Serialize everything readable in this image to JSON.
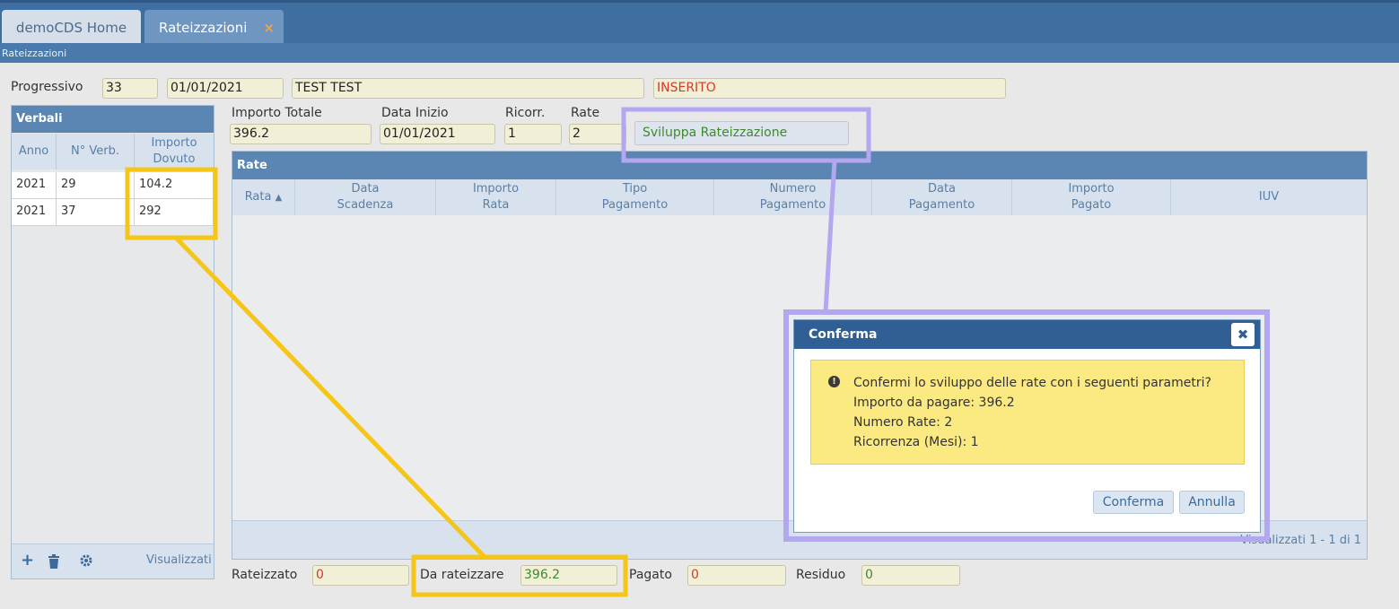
{
  "tabs": [
    {
      "label": "demoCDS Home"
    },
    {
      "label": "Rateizzazioni",
      "close": "×"
    }
  ],
  "breadcrumb": "Rateizzazioni",
  "header": {
    "progressivo_label": "Progressivo",
    "progressivo": "33",
    "data": "01/01/2021",
    "nome": "TEST TEST",
    "stato": "INSERITO"
  },
  "params": {
    "importo_totale_label": "Importo Totale",
    "importo_totale": "396.2",
    "data_inizio_label": "Data Inizio",
    "data_inizio": "01/01/2021",
    "ricorr_label": "Ricorr.",
    "ricorr": "1",
    "rate_label": "Rate",
    "rate": "2",
    "sviluppa_button": "Sviluppa Rateizzazione"
  },
  "verbali": {
    "title": "Verbali",
    "columns": [
      "Anno",
      "N° Verb.",
      "Importo Dovuto"
    ],
    "rows": [
      {
        "anno": "2021",
        "numero": "29",
        "importo": "104.2"
      },
      {
        "anno": "2021",
        "numero": "37",
        "importo": "292"
      }
    ],
    "footer_text": "Visualizzati"
  },
  "rate_grid": {
    "title": "Rate",
    "columns": [
      {
        "line1": "Rata",
        "line2": ""
      },
      {
        "line1": "Data",
        "line2": "Scadenza"
      },
      {
        "line1": "Importo",
        "line2": "Rata"
      },
      {
        "line1": "Tipo",
        "line2": "Pagamento"
      },
      {
        "line1": "Numero",
        "line2": "Pagamento"
      },
      {
        "line1": "Data",
        "line2": "Pagamento"
      },
      {
        "line1": "Importo",
        "line2": "Pagato"
      },
      {
        "line1": "IUV",
        "line2": ""
      }
    ],
    "footer_text": "Visualizzati 1 - 1 di 1"
  },
  "totals": {
    "rateizzato_label": "Rateizzato",
    "rateizzato": "0",
    "da_rateizzare_label": "Da rateizzare",
    "da_rateizzare": "396.2",
    "pagato_label": "Pagato",
    "pagato": "0",
    "residuo_label": "Residuo",
    "residuo": "0"
  },
  "dialog": {
    "title": "Conferma",
    "close": "✖",
    "message_lines": [
      "Confermi lo sviluppo delle rate con i seguenti parametri?",
      "Importo da pagare: 396.2",
      "Numero Rate: 2",
      "Ricorrenza (Mesi): 1"
    ],
    "confirm_button": "Conferma",
    "cancel_button": "Annulla"
  },
  "colors": {
    "highlight_yellow": "#f5c518",
    "highlight_purple": "#b3a7f0"
  }
}
